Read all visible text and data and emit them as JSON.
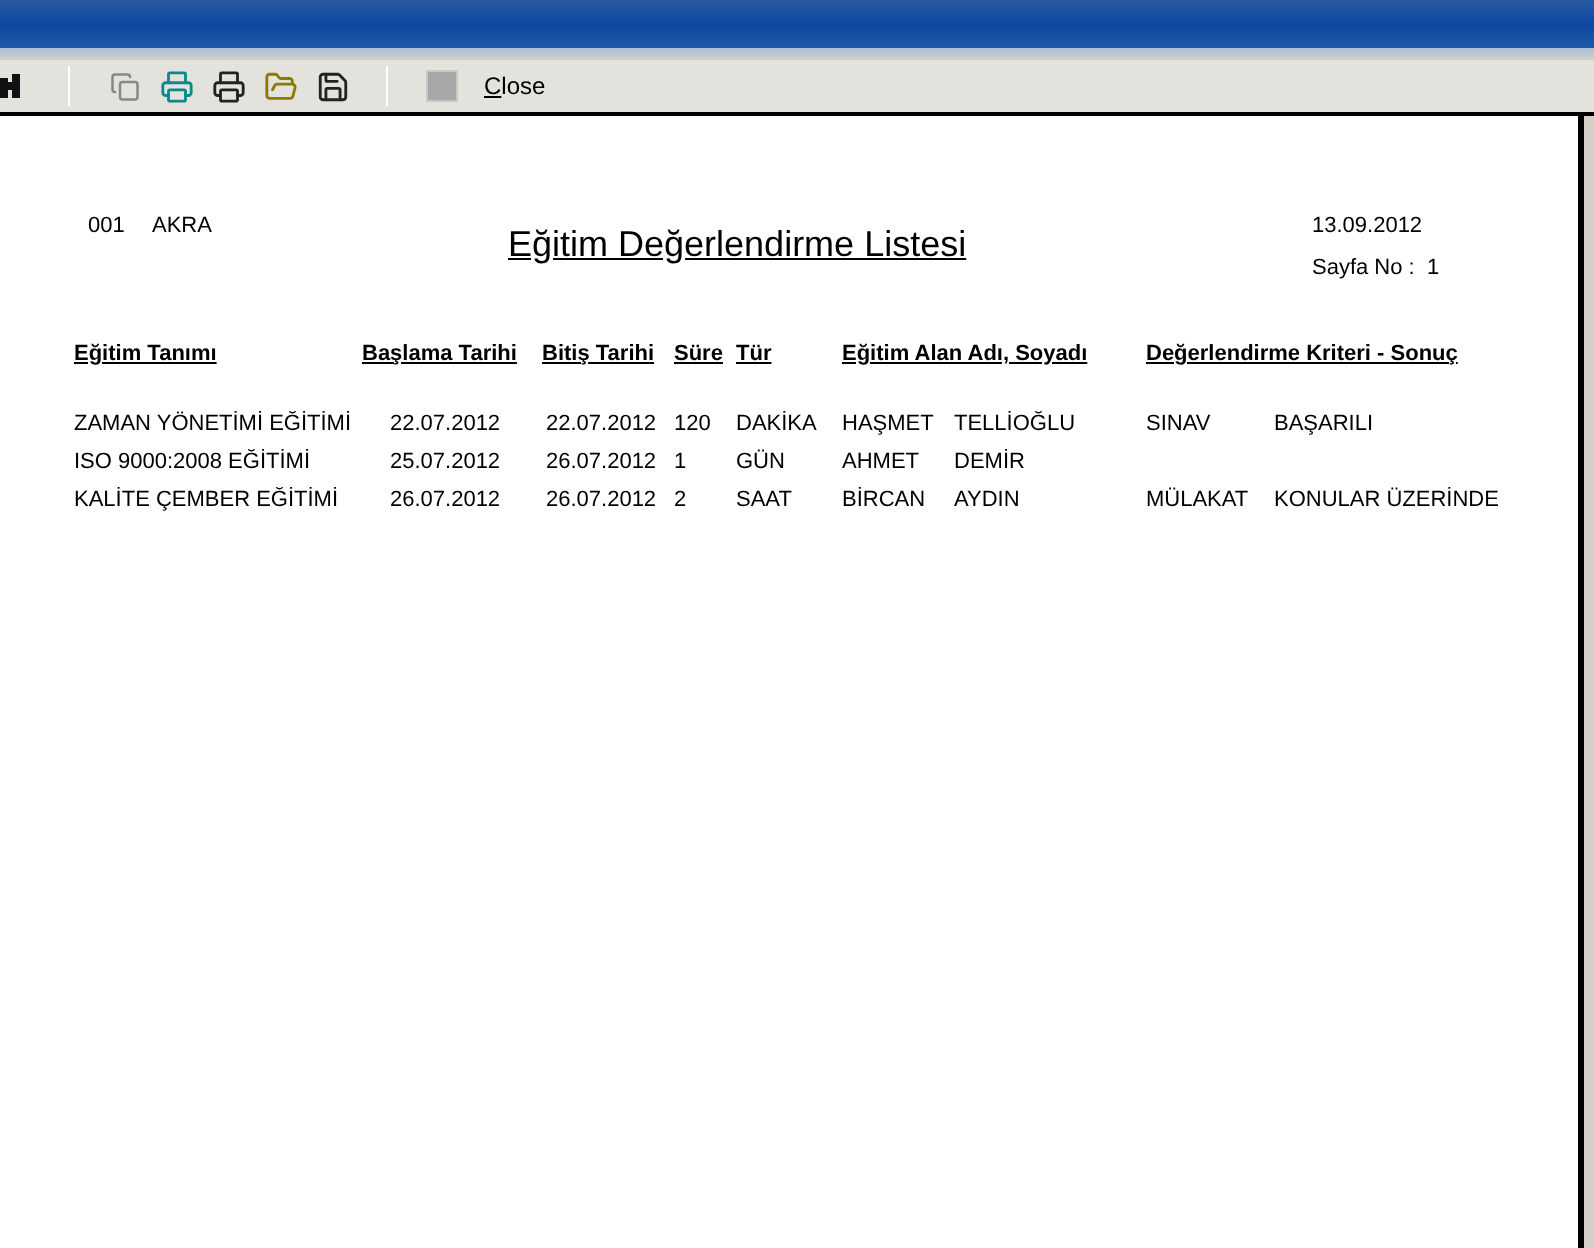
{
  "toolbar": {
    "buttons": [
      {
        "kind": "find",
        "disabled": false
      },
      {
        "kind": "separator"
      },
      {
        "kind": "page",
        "disabled": false
      },
      {
        "kind": "print-setup",
        "disabled": false
      },
      {
        "kind": "print",
        "disabled": false
      },
      {
        "kind": "open",
        "disabled": false
      },
      {
        "kind": "save",
        "disabled": false
      },
      {
        "kind": "separator"
      },
      {
        "kind": "export",
        "disabled": true
      }
    ],
    "close_label": "Close"
  },
  "report": {
    "code": "001",
    "company": "AKRA",
    "title": "Eğitim Değerlendirme Listesi",
    "date": "13.09.2012",
    "page_label": "Sayfa No :",
    "page_number": "1",
    "columns": [
      "Eğitim Tanımı",
      "Başlama Tarihi",
      "Bitiş Tarihi",
      "Süre",
      "Tür",
      "Eğitim Alan Adı, Soyadı",
      "Değerlendirme Kriteri - Sonuç"
    ],
    "rows": [
      {
        "training": "ZAMAN YÖNETİMİ EĞİTİMİ",
        "start": "22.07.2012",
        "end": "22.07.2012",
        "duration": "120",
        "unit": "DAKİKA",
        "first_name": "HAŞMET",
        "last_name": "TELLİOĞLU",
        "criterion": "SINAV",
        "result": "BAŞARILI"
      },
      {
        "training": "ISO 9000:2008 EĞİTİMİ",
        "start": "25.07.2012",
        "end": "26.07.2012",
        "duration": "1",
        "unit": "GÜN",
        "first_name": "AHMET",
        "last_name": "DEMİR"
      },
      {
        "training": "KALİTE ÇEMBER EĞİTİMİ",
        "start": "26.07.2012",
        "end": "26.07.2012",
        "duration": "2",
        "unit": "SAAT",
        "first_name": "BİRCAN",
        "last_name": "AYDIN",
        "criterion": "MÜLAKAT",
        "result": "KONULAR ÜZERİNDE"
      }
    ]
  }
}
